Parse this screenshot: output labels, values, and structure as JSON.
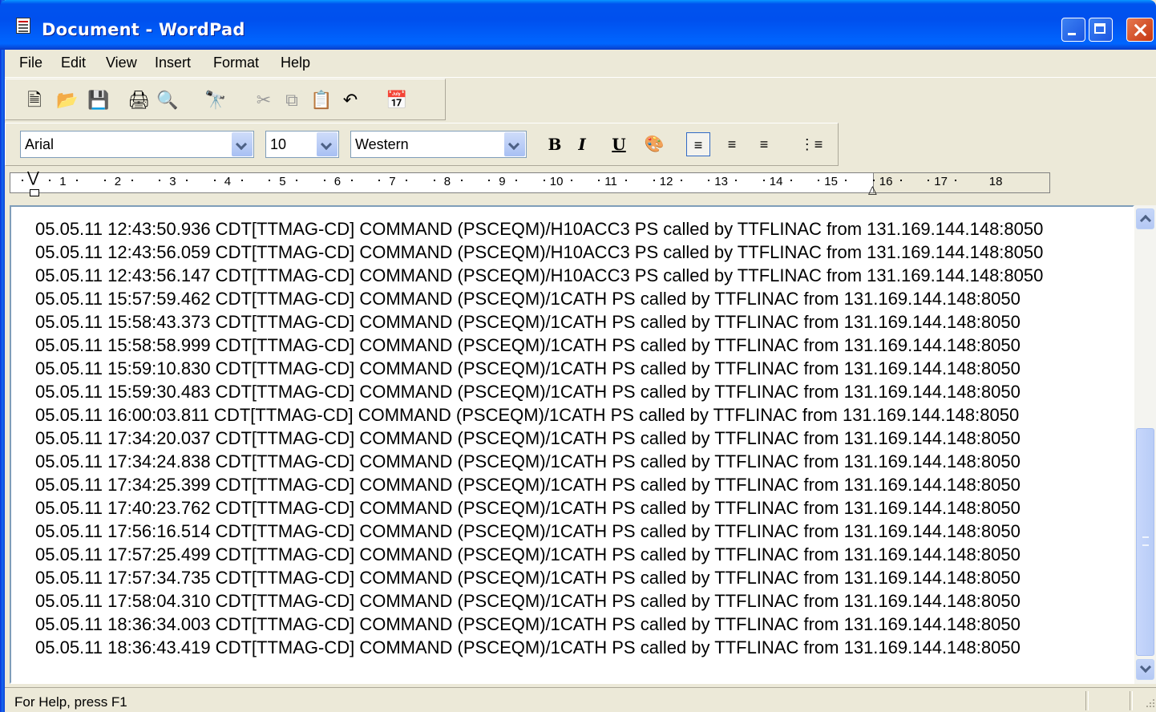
{
  "window": {
    "title": "Document - WordPad",
    "controls": [
      "minimize-icon",
      "maximize-icon",
      "close-icon"
    ]
  },
  "menu": [
    "File",
    "Edit",
    "View",
    "Insert",
    "Format",
    "Help"
  ],
  "toolbar": {
    "icons": [
      "new-icon",
      "open-icon",
      "save-icon",
      "print-icon",
      "print-preview-icon",
      "find-icon",
      "cut-icon",
      "copy-icon",
      "paste-icon",
      "undo-icon",
      "insert-date-time-icon"
    ]
  },
  "format": {
    "font": "Arial",
    "size": "10",
    "script": "Western",
    "bold_label": "B",
    "italic_label": "I",
    "underline_label": "U"
  },
  "ruler": {
    "numbers": [
      "1",
      "2",
      "3",
      "4",
      "5",
      "6",
      "7",
      "8",
      "9",
      "10",
      "11",
      "12",
      "13",
      "14",
      "15",
      "16",
      "17",
      "18"
    ]
  },
  "document": {
    "lines": [
      "05.05.11 12:43:50.936 CDT[TTMAG-CD] COMMAND (PSCEQM)/H10ACC3 PS called by TTFLINAC from 131.169.144.148:8050",
      "05.05.11 12:43:56.059 CDT[TTMAG-CD] COMMAND (PSCEQM)/H10ACC3 PS called by TTFLINAC from 131.169.144.148:8050",
      "05.05.11 12:43:56.147 CDT[TTMAG-CD] COMMAND (PSCEQM)/H10ACC3 PS called by TTFLINAC from 131.169.144.148:8050",
      "05.05.11 15:57:59.462 CDT[TTMAG-CD] COMMAND (PSCEQM)/1CATH PS called by TTFLINAC from 131.169.144.148:8050",
      "05.05.11 15:58:43.373 CDT[TTMAG-CD] COMMAND (PSCEQM)/1CATH PS called by TTFLINAC from 131.169.144.148:8050",
      "05.05.11 15:58:58.999 CDT[TTMAG-CD] COMMAND (PSCEQM)/1CATH PS called by TTFLINAC from 131.169.144.148:8050",
      "05.05.11 15:59:10.830 CDT[TTMAG-CD] COMMAND (PSCEQM)/1CATH PS called by TTFLINAC from 131.169.144.148:8050",
      "05.05.11 15:59:30.483 CDT[TTMAG-CD] COMMAND (PSCEQM)/1CATH PS called by TTFLINAC from 131.169.144.148:8050",
      "05.05.11 16:00:03.811 CDT[TTMAG-CD] COMMAND (PSCEQM)/1CATH PS called by TTFLINAC from 131.169.144.148:8050",
      "05.05.11 17:34:20.037 CDT[TTMAG-CD] COMMAND (PSCEQM)/1CATH PS called by TTFLINAC from 131.169.144.148:8050",
      "05.05.11 17:34:24.838 CDT[TTMAG-CD] COMMAND (PSCEQM)/1CATH PS called by TTFLINAC from 131.169.144.148:8050",
      "05.05.11 17:34:25.399 CDT[TTMAG-CD] COMMAND (PSCEQM)/1CATH PS called by TTFLINAC from 131.169.144.148:8050",
      "05.05.11 17:40:23.762 CDT[TTMAG-CD] COMMAND (PSCEQM)/1CATH PS called by TTFLINAC from 131.169.144.148:8050",
      "05.05.11 17:56:16.514 CDT[TTMAG-CD] COMMAND (PSCEQM)/1CATH PS called by TTFLINAC from 131.169.144.148:8050",
      "05.05.11 17:57:25.499 CDT[TTMAG-CD] COMMAND (PSCEQM)/1CATH PS called by TTFLINAC from 131.169.144.148:8050",
      "05.05.11 17:57:34.735 CDT[TTMAG-CD] COMMAND (PSCEQM)/1CATH PS called by TTFLINAC from 131.169.144.148:8050",
      "05.05.11 17:58:04.310 CDT[TTMAG-CD] COMMAND (PSCEQM)/1CATH PS called by TTFLINAC from 131.169.144.148:8050",
      "05.05.11 18:36:34.003 CDT[TTMAG-CD] COMMAND (PSCEQM)/1CATH PS called by TTFLINAC from 131.169.144.148:8050",
      "05.05.11 18:36:43.419 CDT[TTMAG-CD] COMMAND (PSCEQM)/1CATH PS called by TTFLINAC from 131.169.144.148:8050"
    ]
  },
  "status": {
    "text": "For Help, press F1"
  },
  "colors": {
    "titlebar": "#0054e3",
    "face": "#ece9d8",
    "scroll": "#c1d3fb"
  }
}
